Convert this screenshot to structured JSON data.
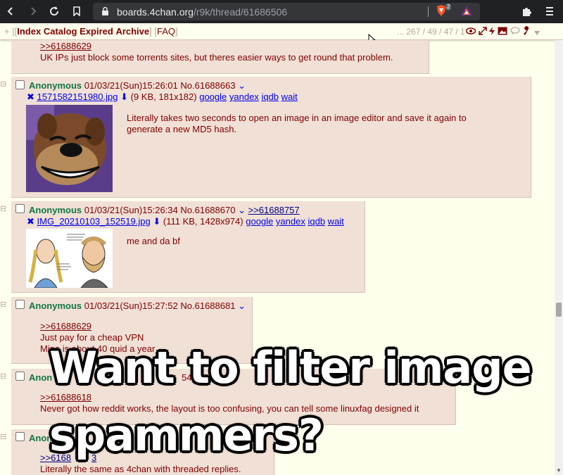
{
  "browser": {
    "url_host": "boards.4chan.org",
    "url_path": "/r9k/thread/61686506",
    "shield_count": "2"
  },
  "boardbar": {
    "plus": "+",
    "sep1": "|",
    "index": "Index",
    "catalog": "Catalog",
    "expired": "Expired",
    "archive": "Archive",
    "faq": "FAQ",
    "stats": "... 267 / 49 / 47 / 1"
  },
  "posts": [
    {
      "quote": ">>61688629",
      "message": "UK IPs just block some torrents sites, but theres easier ways to get round that problem."
    },
    {
      "name": "Anonymous",
      "datetime": "01/03/21(Sun)15:26:01",
      "postno": "No.61688663",
      "filename": "1571582151980.jpg",
      "filemeta": "(9 KB, 181x182)",
      "links": [
        "google",
        "yandex",
        "iqdb",
        "wait"
      ],
      "message": "Literally takes two seconds to open an image in an image editor and save it again to generate a new MD5 hash."
    },
    {
      "name": "Anonymous",
      "datetime": "01/03/21(Sun)15:26:34",
      "postno": "No.61688670",
      "backlink": ">>61688757",
      "filename": "IMG_20210103_152519.jpg",
      "filemeta": "(111 KB, 1428x974)",
      "links": [
        "google",
        "yandex",
        "iqdb",
        "wait"
      ],
      "message": "me and da bf"
    },
    {
      "name": "Anonymous",
      "datetime": "01/03/21(Sun)15:27:52",
      "postno": "No.61688681",
      "quote": ">>61688629",
      "line1": "Just pay for a cheap VPN",
      "line2": "Mine is about 40 quid a year"
    },
    {
      "name": "Anon",
      "dtfrag": "54 No.6168",
      "quote": ">>61688618",
      "message": "Never got how reddit works, the layout is too confusing, you can tell some linuxfag designed it"
    },
    {
      "name": "Anon",
      "quote": ">>6168",
      "quote_tail": "3",
      "message": "Literally the same as 4chan with threaded replies."
    }
  ],
  "overlay": {
    "line1": "Want to filter image",
    "line2": "spammers?"
  },
  "colors": {
    "name_green": "#117743",
    "post_bg": "#f0e0d6",
    "page_bg": "#ffffee",
    "text_maroon": "#800000",
    "link_blue": "#0000ee"
  }
}
